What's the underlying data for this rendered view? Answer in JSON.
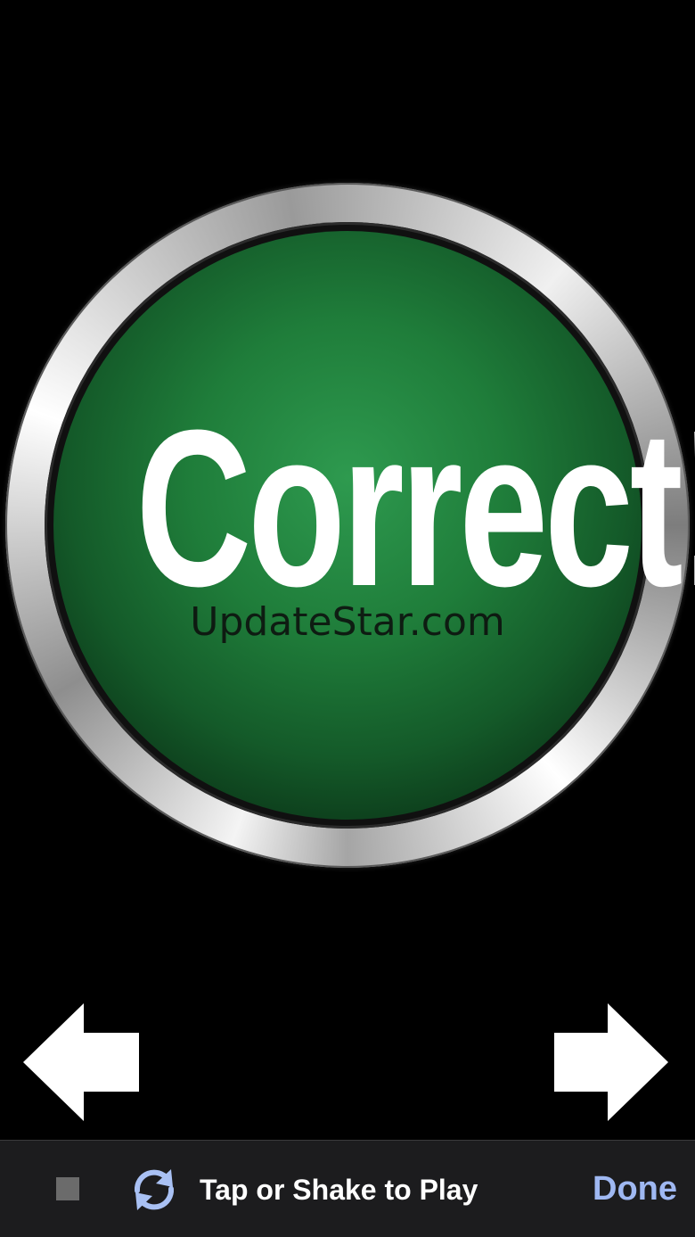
{
  "main": {
    "button_text": "Correct!",
    "watermark": "UpdateStar.com",
    "colors": {
      "face": "#1f7d3a",
      "ring": "#d9d9d9",
      "background": "#000000"
    },
    "previous_icon": "arrow-left-icon",
    "next_icon": "arrow-right-icon"
  },
  "toolbar": {
    "stop_icon": "stop-icon",
    "refresh_icon": "refresh-icon",
    "play_label": "Tap or Shake to Play",
    "done_label": "Done",
    "colors": {
      "background": "#1c1c1e",
      "done": "#9fb8f2",
      "refresh": "#a9c1f4"
    }
  }
}
